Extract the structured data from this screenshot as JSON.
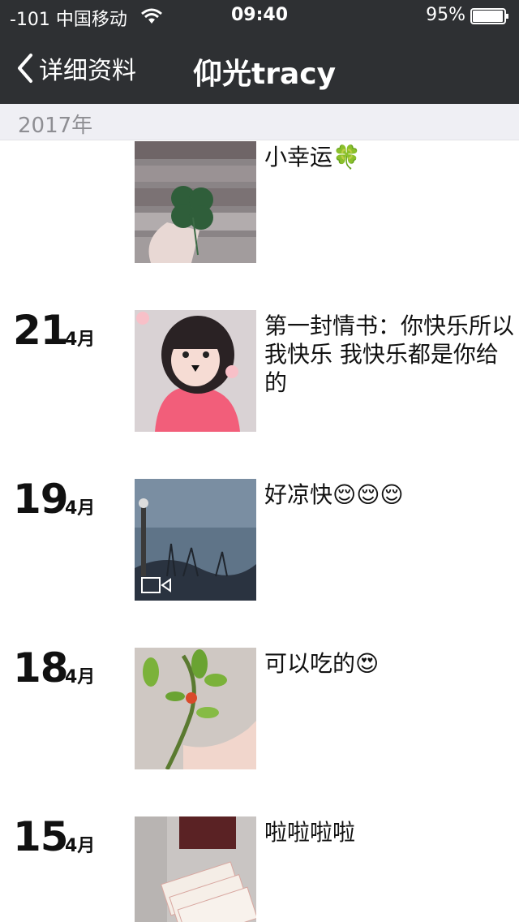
{
  "status_bar": {
    "carrier": "-101 中国移动",
    "time": "09:40",
    "battery": "95%"
  },
  "nav": {
    "back_label": "详细资料",
    "title": "仰光tracy"
  },
  "year_header": "2017年",
  "posts": [
    {
      "day": "",
      "month": "",
      "caption": "小幸运🍀",
      "image": "four-leaf-clover-photo"
    },
    {
      "day": "21",
      "month": "4月",
      "caption": "第一封情书：你快乐所以我快乐 我快乐都是你给的",
      "image": "selfie-photo"
    },
    {
      "day": "19",
      "month": "4月",
      "caption": "好凉快😌😌😌",
      "image": "cloudy-sky-video",
      "is_video": true
    },
    {
      "day": "18",
      "month": "4月",
      "caption": "可以吃的😍",
      "image": "plant-branch-photo"
    },
    {
      "day": "15",
      "month": "4月",
      "caption": "啦啦啦啦",
      "image": "tickets-photo"
    }
  ],
  "colors": {
    "nav_bg": "#2e3033",
    "year_bg": "#efeff4"
  }
}
